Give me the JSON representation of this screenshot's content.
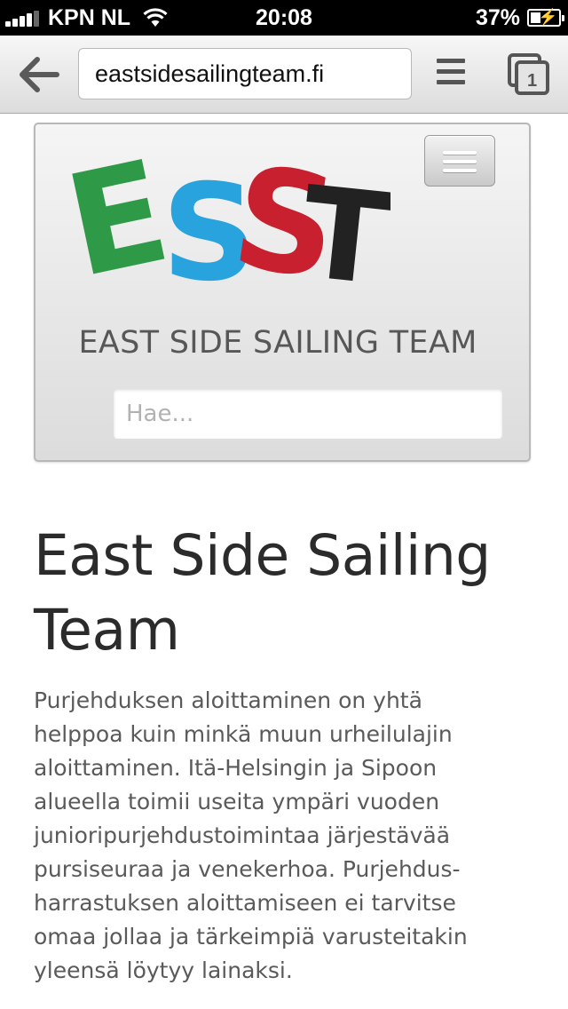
{
  "status_bar": {
    "carrier": "KPN NL",
    "time": "20:08",
    "battery_percent": "37%",
    "battery_level": 0.37,
    "signal_bars": 4
  },
  "browser": {
    "url": "eastsidesailingteam.fi",
    "tab_count": "1",
    "icons": {
      "back": "back-arrow-icon",
      "menu": "menu-icon",
      "tabs": "tabs-icon"
    }
  },
  "site_header": {
    "logo_text": "ESST",
    "logo_colors": {
      "E": "#2e9a48",
      "S1": "#29a3de",
      "S2": "#c8202f",
      "T": "#222222"
    },
    "site_title": "EAST SIDE SAILING TEAM",
    "search_placeholder": "Hae..."
  },
  "content": {
    "heading": "East Side Sailing Team",
    "intro": "Purjehduksen aloittaminen on yhtä\nhelppoa kuin minkä muun urheilulajin\naloittaminen. Itä-Helsingin ja Sipoon\nalueella toimii useita ympäri vuoden\njunioripurjehdustoimintaa järjestävää\npursiseuraa ja venekerhoa. Purjehdus-\nharrastuksen aloittamiseen ei tarvitse\nomaa jollaa ja tärkeimpiä varusteitakin\nyleensä löytyy lainaksi."
  }
}
